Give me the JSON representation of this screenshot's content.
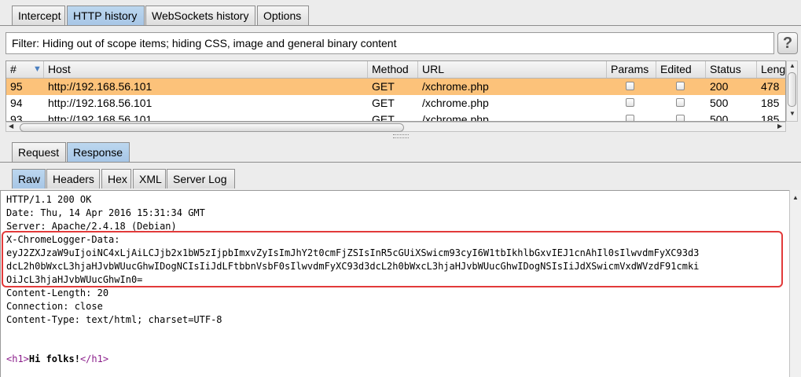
{
  "main_tabs": [
    "Intercept",
    "HTTP history",
    "WebSockets history",
    "Options"
  ],
  "filter_text": "Filter: Hiding out of scope items;  hiding CSS, image and general binary content",
  "help_label": "?",
  "table": {
    "columns": [
      "#",
      "Host",
      "Method",
      "URL",
      "Params",
      "Edited",
      "Status",
      "Lengt"
    ],
    "sort_indicator": "▼",
    "rows": [
      {
        "num": "95",
        "host": "http://192.168.56.101",
        "method": "GET",
        "url": "/xchrome.php",
        "status": "200",
        "length": "478"
      },
      {
        "num": "94",
        "host": "http://192.168.56.101",
        "method": "GET",
        "url": "/xchrome.php",
        "status": "500",
        "length": "185"
      },
      {
        "num": "93",
        "host": "http://192.168.56.101",
        "method": "GET",
        "url": "/xchrome.php",
        "status": "500",
        "length": "185"
      }
    ]
  },
  "req_tabs": [
    "Request",
    "Response"
  ],
  "view_tabs": [
    "Raw",
    "Headers",
    "Hex",
    "XML",
    "Server Log"
  ],
  "response": {
    "lines": [
      "HTTP/1.1 200 OK",
      "Date: Thu, 14 Apr 2016 15:31:34 GMT",
      "Server: Apache/2.4.18 (Debian)",
      "X-ChromeLogger-Data:",
      "eyJ2ZXJzaW9uIjoiNC4xLjAiLCJjb2x1bW5zIjpbImxvZyIsImJhY2t0cmFjZSIsInR5cGUiXSwicm93cyI6W1tbIkhlbGxvIEJ1cnAhIl0sIlwvdmFyXC93d3",
      "dcL2h0bWxcL3hjaHJvbWUucGhwIDogNCIsIiJdLFtbbnVsbF0sIlwvdmFyXC93d3dcL2h0bWxcL3hjaHJvbWUucGhwIDogNSIsIiJdXSwicmVxdWVzdF91cmki",
      "OiJcL3hjaHJvbWUucGhwIn0=",
      "Content-Length: 20",
      "Connection: close",
      "Content-Type: text/html; charset=UTF-8",
      "",
      ""
    ],
    "html_open_tag": "<h1>",
    "html_text": "Hi folks!",
    "html_close_tag": "</h1>"
  }
}
